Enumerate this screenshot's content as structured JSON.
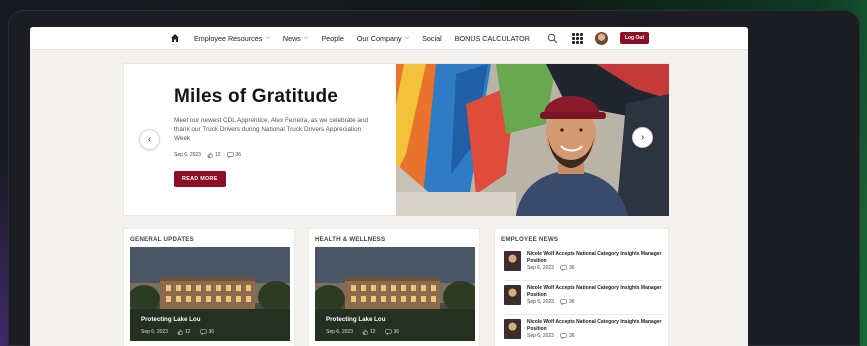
{
  "nav": {
    "items": [
      {
        "label": "Employee Resources",
        "has_dropdown": true
      },
      {
        "label": "News",
        "has_dropdown": true
      },
      {
        "label": "People",
        "has_dropdown": false
      },
      {
        "label": "Our Company",
        "has_dropdown": true
      },
      {
        "label": "Social",
        "has_dropdown": false
      },
      {
        "label": "BONUS CALCULATOR",
        "has_dropdown": false
      }
    ],
    "logout_label": "Log Out",
    "icons": [
      "home-icon",
      "search-icon",
      "apps-grid-icon",
      "avatar"
    ]
  },
  "hero": {
    "title": "Miles of Gratitude",
    "description": "Meet our newest CDL Apprentice, Alex Ferreira, as we celebrate and thank our Truck Drivers during National Truck Drivers Appreciation Week",
    "date": "Sep 6, 2023",
    "likes": "12",
    "comments": "36",
    "read_more_label": "READ MORE",
    "prev_arrow": "‹",
    "next_arrow": "›"
  },
  "cards": [
    {
      "heading": "GENERAL UPDATES",
      "caption": "Protecting Lake Lou",
      "date": "Sep 6, 2023",
      "likes": "12",
      "comments": "36"
    },
    {
      "heading": "HEALTH & WELLNESS",
      "caption": "Protecting Lake Lou",
      "date": "Sep 6, 2023",
      "likes": "12",
      "comments": "36"
    }
  ],
  "employee_news": {
    "heading": "EMPLOYEE NEWS",
    "items": [
      {
        "title": "Nicole Wolf Accepts National Category Insights Manager Position",
        "date": "Sep 6, 2023",
        "comments": "36"
      },
      {
        "title": "Nicole Wolf Accepts National Category Insights Manager Position",
        "date": "Sep 6, 2023",
        "comments": "36"
      },
      {
        "title": "Nicole Wolf Accepts National Category Insights Manager Position",
        "date": "Sep 6, 2023",
        "comments": "36"
      }
    ]
  },
  "colors": {
    "accent": "#8b0e23",
    "page_bg": "#f4f2ef"
  }
}
